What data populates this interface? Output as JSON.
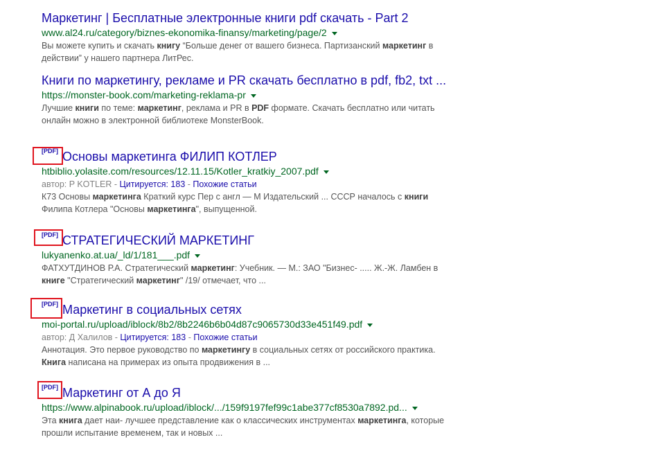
{
  "colors": {
    "link": "#1a0dab",
    "url": "#006621",
    "snippet": "#545454",
    "meta": "#808080",
    "highlight": "#e0141e"
  },
  "icons": {
    "url_menu": "chevron-down-icon"
  },
  "results": [
    {
      "title": "Маркетинг | Бесплатные электронные книги pdf скачать - Part 2",
      "url": "www.al24.ru/category/biznes-ekonomika-finansy/marketing/page/2",
      "snippet": [
        {
          "t": "Вы можете купить и скачать ",
          "b": false
        },
        {
          "t": "книгу",
          "b": true
        },
        {
          "t": " “Больше денег от вашего бизнеса. Партизанский ",
          "b": false
        },
        {
          "t": "маркетинг",
          "b": true
        },
        {
          "t": " в действии” у нашего партнера ЛитРес.",
          "b": false
        }
      ]
    },
    {
      "title": "Книги по маркетингу, рекламе и PR скачать бесплатно в pdf, fb2, txt ...",
      "url": "https://monster-book.com/marketing-reklama-pr",
      "snippet": [
        {
          "t": "Лучшие ",
          "b": false
        },
        {
          "t": "книги",
          "b": true
        },
        {
          "t": " по теме: ",
          "b": false
        },
        {
          "t": "маркетинг",
          "b": true
        },
        {
          "t": ", реклама и PR в ",
          "b": false
        },
        {
          "t": "PDF",
          "b": true
        },
        {
          "t": " формате. Скачать бесплатно или читать онлайн можно в электронной библиотеке MonsterBook.",
          "b": false
        }
      ]
    },
    {
      "pdf_tag": "[PDF]",
      "title": "Основы маркетинга ФИЛИП КОТЛЕР",
      "url": "htbiblio.yolasite.com/resources/12.11.15/Kotler_kratkiy_2007.pdf",
      "meta": {
        "author": "автор: P KOTLER",
        "sep": " - ",
        "cited": "Цитируется: 183",
        "related": "Похожие статьи"
      },
      "snippet": [
        {
          "t": "К73 Основы ",
          "b": false
        },
        {
          "t": "маркетинга",
          "b": true
        },
        {
          "t": " Краткий курс Пер с англ — М Издательский ... СССР началось с ",
          "b": false
        },
        {
          "t": "книги",
          "b": true
        },
        {
          "t": " Филипа Котлера \"Основы ",
          "b": false
        },
        {
          "t": "маркетинга",
          "b": true
        },
        {
          "t": "\", выпущенной.",
          "b": false
        }
      ]
    },
    {
      "pdf_tag": "[PDF]",
      "title": "СТРАТЕГИЧЕСКИЙ МАРКЕТИНГ",
      "url": "lukyanenko.at.ua/_ld/1/181___.pdf",
      "snippet": [
        {
          "t": "ФАТХУТДИНОВ Р.А. Стратегический ",
          "b": false
        },
        {
          "t": "маркетинг",
          "b": true
        },
        {
          "t": ": Учебник. — М.: ЗАО \"Бизнес- ..... Ж.-Ж. Ламбен в ",
          "b": false
        },
        {
          "t": "книге",
          "b": true
        },
        {
          "t": " \"Стратегический ",
          "b": false
        },
        {
          "t": "маркетинг",
          "b": true
        },
        {
          "t": "\" /19/ отмечает, что ...",
          "b": false
        }
      ]
    },
    {
      "pdf_tag": "[PDF]",
      "title": "Маркетинг в социальных сетях",
      "url": "moi-portal.ru/upload/iblock/8b2/8b2246b6b04d87c9065730d33e451f49.pdf",
      "meta": {
        "author": "автор: Д Халилов",
        "sep": " - ",
        "cited": "Цитируется: 183",
        "related": "Похожие статьи"
      },
      "snippet": [
        {
          "t": "Аннотация. Это первое руководство по ",
          "b": false
        },
        {
          "t": "маркетингу",
          "b": true
        },
        {
          "t": " в социальных сетях от российского практика. ",
          "b": false
        },
        {
          "t": "Книга",
          "b": true
        },
        {
          "t": " написана на примерах из опыта продвижения в ...",
          "b": false
        }
      ]
    },
    {
      "pdf_tag": "[PDF]",
      "title": "Маркетинг от А до Я",
      "url": "https://www.alpinabook.ru/upload/iblock/.../159f9197fef99c1abe377cf8530a7892.pd...",
      "snippet": [
        {
          "t": "Эта ",
          "b": false
        },
        {
          "t": "книга",
          "b": true
        },
        {
          "t": " дает наи- лучшее представление как о классических инструментах ",
          "b": false
        },
        {
          "t": "маркетинга",
          "b": true
        },
        {
          "t": ", которые прошли испытание временем, так и новых ...",
          "b": false
        }
      ]
    }
  ]
}
